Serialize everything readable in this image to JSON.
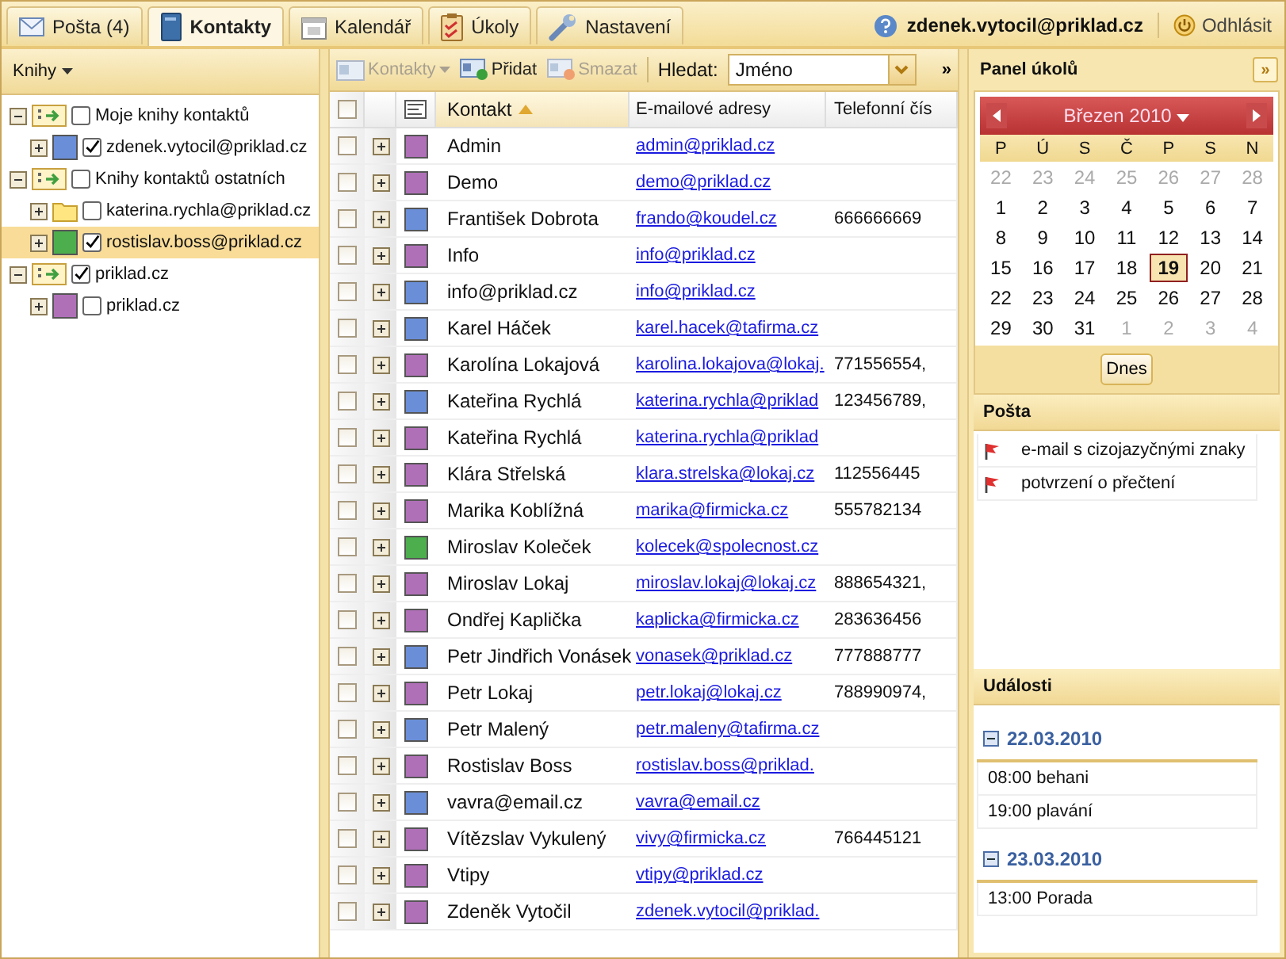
{
  "tabs": [
    {
      "label": "Pošta (4)",
      "kind": "mail",
      "selected": false
    },
    {
      "label": "Kontakty",
      "kind": "contacts",
      "selected": true
    },
    {
      "label": "Kalendář",
      "kind": "calendar",
      "selected": false
    },
    {
      "label": "Úkoly",
      "kind": "tasks",
      "selected": false
    },
    {
      "label": "Nastavení",
      "kind": "settings",
      "selected": false
    }
  ],
  "user": {
    "email": "zdenek.vytocil@priklad.cz",
    "logout": "Odhlásit"
  },
  "sidebar": {
    "title": "Knihy",
    "tree": [
      {
        "label": "Moje knihy kontaktů",
        "kind": "group",
        "checked": false,
        "selected": false,
        "children": [
          {
            "label": "zdenek.vytocil@priklad.cz",
            "kind": "book",
            "color": "#6a8fd8",
            "checked": true,
            "selected": false
          }
        ]
      },
      {
        "label": "Knihy kontaktů ostatních",
        "kind": "group",
        "checked": false,
        "selected": false,
        "children": [
          {
            "label": "katerina.rychla@priklad.cz",
            "kind": "folder",
            "checked": false,
            "selected": false
          },
          {
            "label": "rostislav.boss@priklad.cz",
            "kind": "book",
            "color": "#4cae4c",
            "checked": true,
            "selected": true
          }
        ]
      },
      {
        "label": "priklad.cz",
        "kind": "group",
        "checked": true,
        "selected": false,
        "children": [
          {
            "label": "priklad.cz",
            "kind": "book",
            "color": "#b070b8",
            "checked": false,
            "selected": false
          }
        ]
      }
    ]
  },
  "toolbar": {
    "contacts": "Kontakty",
    "add": "Přidat",
    "delete": "Smazat",
    "search_label": "Hledat:",
    "search_value": "Jméno",
    "more": "»"
  },
  "table": {
    "select_all_checked": false,
    "columns": [
      "Kontakt",
      "E-mailové adresy",
      "Telefonní čís"
    ],
    "rows": [
      {
        "name": "Admin",
        "email": "admin@priklad.cz",
        "phone": "",
        "color": "#b070b8",
        "checked": false
      },
      {
        "name": "Demo",
        "email": "demo@priklad.cz",
        "phone": "",
        "color": "#b070b8",
        "checked": false
      },
      {
        "name": "František Dobrota",
        "email": "frando@koudel.cz",
        "phone": "666666669",
        "color": "#6a8fd8",
        "checked": false
      },
      {
        "name": "Info",
        "email": "info@priklad.cz",
        "phone": "",
        "color": "#b070b8",
        "checked": false
      },
      {
        "name": "info@priklad.cz",
        "email": "info@priklad.cz",
        "phone": "",
        "color": "#6a8fd8",
        "checked": false
      },
      {
        "name": "Karel Háček",
        "email": "karel.hacek@tafirma.cz",
        "phone": "",
        "color": "#6a8fd8",
        "checked": false
      },
      {
        "name": "Karolína Lokajová",
        "email": "karolina.lokajova@lokaj.",
        "phone": "771556554,",
        "color": "#b070b8",
        "checked": false
      },
      {
        "name": "Kateřina Rychlá",
        "email": "katerina.rychla@priklad",
        "phone": "123456789,",
        "color": "#6a8fd8",
        "checked": false
      },
      {
        "name": "Kateřina Rychlá",
        "email": "katerina.rychla@priklad",
        "phone": "",
        "color": "#b070b8",
        "checked": false
      },
      {
        "name": "Klára Střelská",
        "email": "klara.strelska@lokaj.cz",
        "phone": "112556445",
        "color": "#b070b8",
        "checked": false
      },
      {
        "name": "Marika Koblížná",
        "email": "marika@firmicka.cz",
        "phone": "555782134",
        "color": "#b070b8",
        "checked": false
      },
      {
        "name": "Miroslav Koleček",
        "email": "kolecek@spolecnost.cz",
        "phone": "",
        "color": "#4cae4c",
        "checked": false
      },
      {
        "name": "Miroslav Lokaj",
        "email": "miroslav.lokaj@lokaj.cz",
        "phone": "888654321,",
        "color": "#b070b8",
        "checked": false
      },
      {
        "name": "Ondřej Kaplička",
        "email": "kaplicka@firmicka.cz",
        "phone": "283636456",
        "color": "#b070b8",
        "checked": false
      },
      {
        "name": "Petr Jindřich Vonásek",
        "email": "vonasek@priklad.cz",
        "phone": "777888777",
        "color": "#6a8fd8",
        "checked": false
      },
      {
        "name": "Petr Lokaj",
        "email": "petr.lokaj@lokaj.cz",
        "phone": "788990974,",
        "color": "#b070b8",
        "checked": false
      },
      {
        "name": "Petr Malený",
        "email": "petr.maleny@tafirma.cz",
        "phone": "",
        "color": "#6a8fd8",
        "checked": false
      },
      {
        "name": "Rostislav Boss",
        "email": "rostislav.boss@priklad.",
        "phone": "",
        "color": "#b070b8",
        "checked": false
      },
      {
        "name": "vavra@email.cz",
        "email": "vavra@email.cz",
        "phone": "",
        "color": "#6a8fd8",
        "checked": false
      },
      {
        "name": "Vítězslav Vykulený",
        "email": "vivy@firmicka.cz",
        "phone": "766445121",
        "color": "#b070b8",
        "checked": false
      },
      {
        "name": "Vtipy",
        "email": "vtipy@priklad.cz",
        "phone": "",
        "color": "#b070b8",
        "checked": false
      },
      {
        "name": "Zdeněk Vytočil",
        "email": "zdenek.vytocil@priklad.",
        "phone": "",
        "color": "#b070b8",
        "checked": false
      }
    ]
  },
  "task_panel": {
    "title": "Panel úkolů",
    "collapse": "»"
  },
  "calendar": {
    "month": "Březen 2010",
    "weekdays": [
      "P",
      "Ú",
      "S",
      "Č",
      "P",
      "S",
      "N"
    ],
    "days": [
      {
        "day": "22",
        "other": true,
        "selected": false
      },
      {
        "day": "23",
        "other": true,
        "selected": false
      },
      {
        "day": "24",
        "other": true,
        "selected": false
      },
      {
        "day": "25",
        "other": true,
        "selected": false
      },
      {
        "day": "26",
        "other": true,
        "selected": false
      },
      {
        "day": "27",
        "other": true,
        "selected": false
      },
      {
        "day": "28",
        "other": true,
        "selected": false
      },
      {
        "day": "1",
        "other": false,
        "selected": false
      },
      {
        "day": "2",
        "other": false,
        "selected": false
      },
      {
        "day": "3",
        "other": false,
        "selected": false
      },
      {
        "day": "4",
        "other": false,
        "selected": false
      },
      {
        "day": "5",
        "other": false,
        "selected": false
      },
      {
        "day": "6",
        "other": false,
        "selected": false
      },
      {
        "day": "7",
        "other": false,
        "selected": false
      },
      {
        "day": "8",
        "other": false,
        "selected": false
      },
      {
        "day": "9",
        "other": false,
        "selected": false
      },
      {
        "day": "10",
        "other": false,
        "selected": false
      },
      {
        "day": "11",
        "other": false,
        "selected": false
      },
      {
        "day": "12",
        "other": false,
        "selected": false
      },
      {
        "day": "13",
        "other": false,
        "selected": false
      },
      {
        "day": "14",
        "other": false,
        "selected": false
      },
      {
        "day": "15",
        "other": false,
        "selected": false
      },
      {
        "day": "16",
        "other": false,
        "selected": false
      },
      {
        "day": "17",
        "other": false,
        "selected": false
      },
      {
        "day": "18",
        "other": false,
        "selected": false
      },
      {
        "day": "19",
        "other": false,
        "selected": true
      },
      {
        "day": "20",
        "other": false,
        "selected": false
      },
      {
        "day": "21",
        "other": false,
        "selected": false
      },
      {
        "day": "22",
        "other": false,
        "selected": false
      },
      {
        "day": "23",
        "other": false,
        "selected": false
      },
      {
        "day": "24",
        "other": false,
        "selected": false
      },
      {
        "day": "25",
        "other": false,
        "selected": false
      },
      {
        "day": "26",
        "other": false,
        "selected": false
      },
      {
        "day": "27",
        "other": false,
        "selected": false
      },
      {
        "day": "28",
        "other": false,
        "selected": false
      },
      {
        "day": "29",
        "other": false,
        "selected": false
      },
      {
        "day": "30",
        "other": false,
        "selected": false
      },
      {
        "day": "31",
        "other": false,
        "selected": false
      },
      {
        "day": "1",
        "other": true,
        "selected": false
      },
      {
        "day": "2",
        "other": true,
        "selected": false
      },
      {
        "day": "3",
        "other": true,
        "selected": false
      },
      {
        "day": "4",
        "other": true,
        "selected": false
      }
    ],
    "today": "Dnes"
  },
  "mail": {
    "title": "Pošta",
    "items": [
      "e-mail s cizojazyčnými znaky",
      "potvrzení o přečtení"
    ]
  },
  "events": {
    "title": "Události",
    "days": [
      {
        "date": "22.03.2010",
        "expanded": true,
        "items": [
          "08:00 behani",
          "19:00 plavání"
        ]
      },
      {
        "date": "23.03.2010",
        "expanded": true,
        "items": [
          "13:00 Porada"
        ]
      }
    ]
  }
}
